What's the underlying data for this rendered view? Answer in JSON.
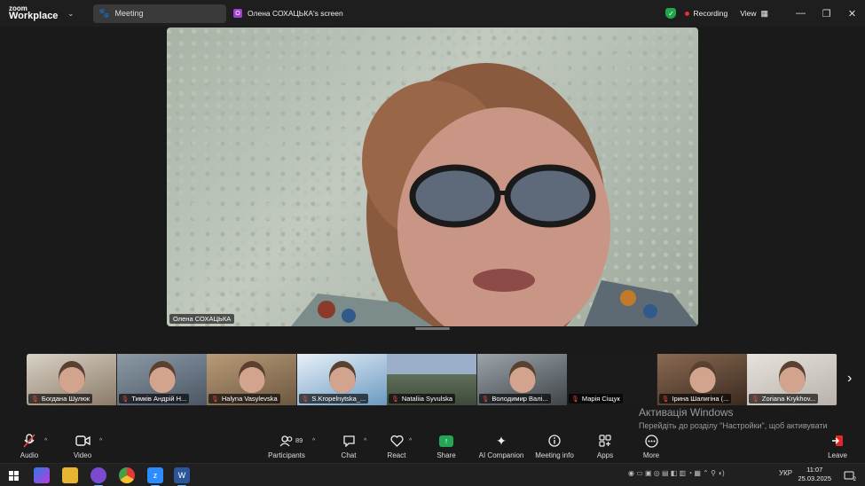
{
  "app": {
    "logo_line1": "zoom",
    "logo_line2": "Workplace"
  },
  "tabs": {
    "meeting": "Meeting",
    "screen": "Олена СОХАЦЬКА's screen",
    "screen_badge": "O"
  },
  "status": {
    "recording": "Recording",
    "view": "View"
  },
  "main_video": {
    "speaker_name": "Олена СОХАЦЬКА"
  },
  "gallery": [
    {
      "name": "Богдана Шулюк",
      "muted": true
    },
    {
      "name": "Тимків Андрій Н...",
      "muted": true
    },
    {
      "name": "Halyna Vasylevska",
      "muted": true
    },
    {
      "name": "S.Kropelnytska_...",
      "muted": true
    },
    {
      "name": "Nataliia Syvulska",
      "muted": true
    },
    {
      "name": "Володимир Валі...",
      "muted": true
    },
    {
      "name": "Марія Сіщук",
      "muted": true
    },
    {
      "name": "Ірина Шалигіна (...",
      "muted": true
    },
    {
      "name": "Zoriana Krykhov...",
      "muted": true
    }
  ],
  "activation": {
    "title": "Активація Windows",
    "subtitle": "Перейдіть до розділу \"Настройки\", щоб активувати Windows."
  },
  "toolbar": {
    "audio": "Audio",
    "video": "Video",
    "participants": "Participants",
    "participants_count": "89",
    "chat": "Chat",
    "react": "React",
    "share": "Share",
    "ai_companion": "AI Companion",
    "meeting_info": "Meeting info",
    "apps": "Apps",
    "more": "More",
    "leave": "Leave"
  },
  "taskbar": {
    "language": "УКР",
    "time": "11:07",
    "date": "25.03.2025",
    "notification_count": "2"
  },
  "colors": {
    "recording_dot": "#e03030",
    "shield": "#1ea84b",
    "share": "#24a654",
    "leave": "#e02828",
    "muted": "#e24848"
  }
}
